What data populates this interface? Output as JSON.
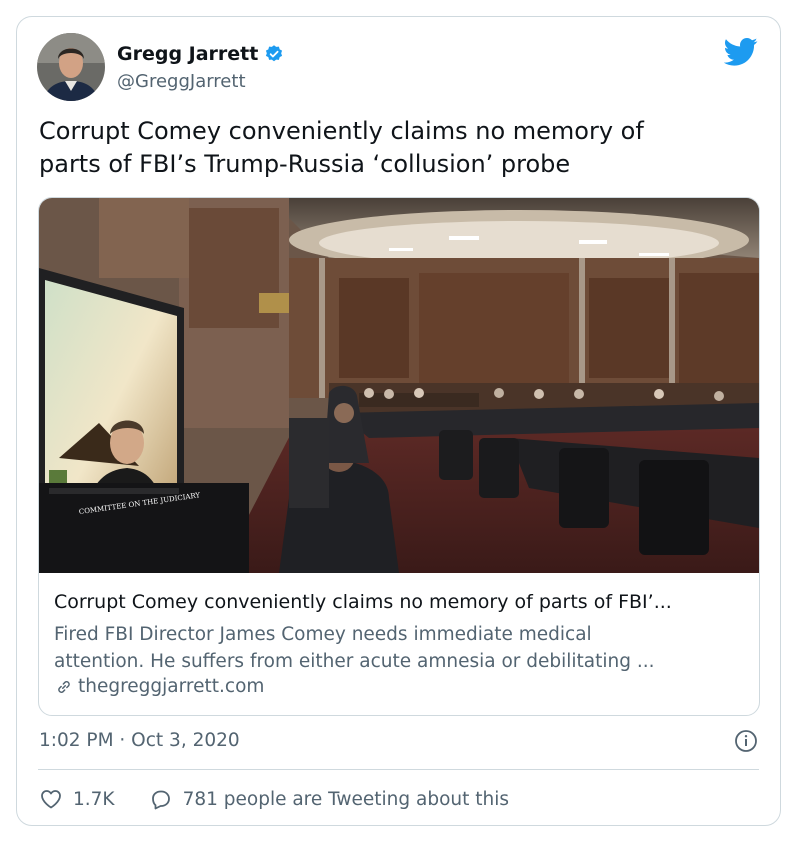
{
  "author": {
    "name": "Gregg Jarrett",
    "handle": "@GreggJarrett",
    "verified": true
  },
  "tweet": {
    "text_line1": "Corrupt Comey conveniently claims no memory of",
    "text_line2": "parts of FBI’s Trump-Russia ‘collusion’ probe"
  },
  "card": {
    "title": "Corrupt Comey conveniently claims no memory of parts of FBI’...",
    "description_line1": "Fired FBI Director James Comey needs immediate medical",
    "description_line2": "attention. He suffers from either acute amnesia or debilitating ...",
    "domain": "thegreggjarrett.com",
    "monitor_caption": "COMMITTEE ON THE JUDICIARY"
  },
  "meta": {
    "timestamp": "1:02 PM · Oct 3, 2020"
  },
  "actions": {
    "likes": "1.7K",
    "tweeting_about": "781 people are Tweeting about this"
  },
  "colors": {
    "brand_blue": "#1d9bf0",
    "text_primary": "#0f1419",
    "text_secondary": "#536471",
    "border": "#cfd9de"
  },
  "icons": [
    "verified-badge-icon",
    "twitter-bird-icon",
    "link-icon",
    "info-icon",
    "heart-icon",
    "reply-bubble-icon"
  ]
}
